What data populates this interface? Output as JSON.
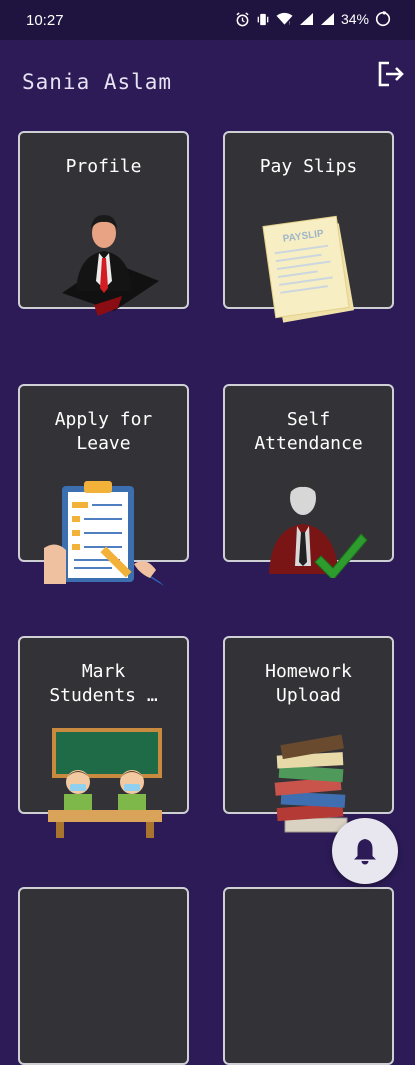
{
  "status_bar": {
    "time": "10:27",
    "battery": "34%",
    "icons": [
      "alarm-icon",
      "vibrate-icon",
      "wifi-icon",
      "signal-icon",
      "signal-icon",
      "battery-icon"
    ]
  },
  "header": {
    "user_name": "Sania Aslam",
    "logout_icon": "logout-icon"
  },
  "tiles": [
    {
      "label": "Profile",
      "icon": "profile-icon"
    },
    {
      "label": "Pay Slips",
      "icon": "payslip-icon",
      "illustration_text": "PAYSLIP"
    },
    {
      "label": "Apply for\nLeave",
      "icon": "leave-form-icon"
    },
    {
      "label": "Self\nAttendance",
      "icon": "attendance-icon"
    },
    {
      "label": "Mark\nStudents …",
      "icon": "classroom-icon"
    },
    {
      "label": "Homework\nUpload",
      "icon": "books-icon"
    }
  ],
  "fab": {
    "icon": "bell-icon"
  },
  "colors": {
    "background": "#2c1b57",
    "status_bar": "#1f1440",
    "tile_background": "#333337",
    "tile_border": "#cfcfd6"
  }
}
